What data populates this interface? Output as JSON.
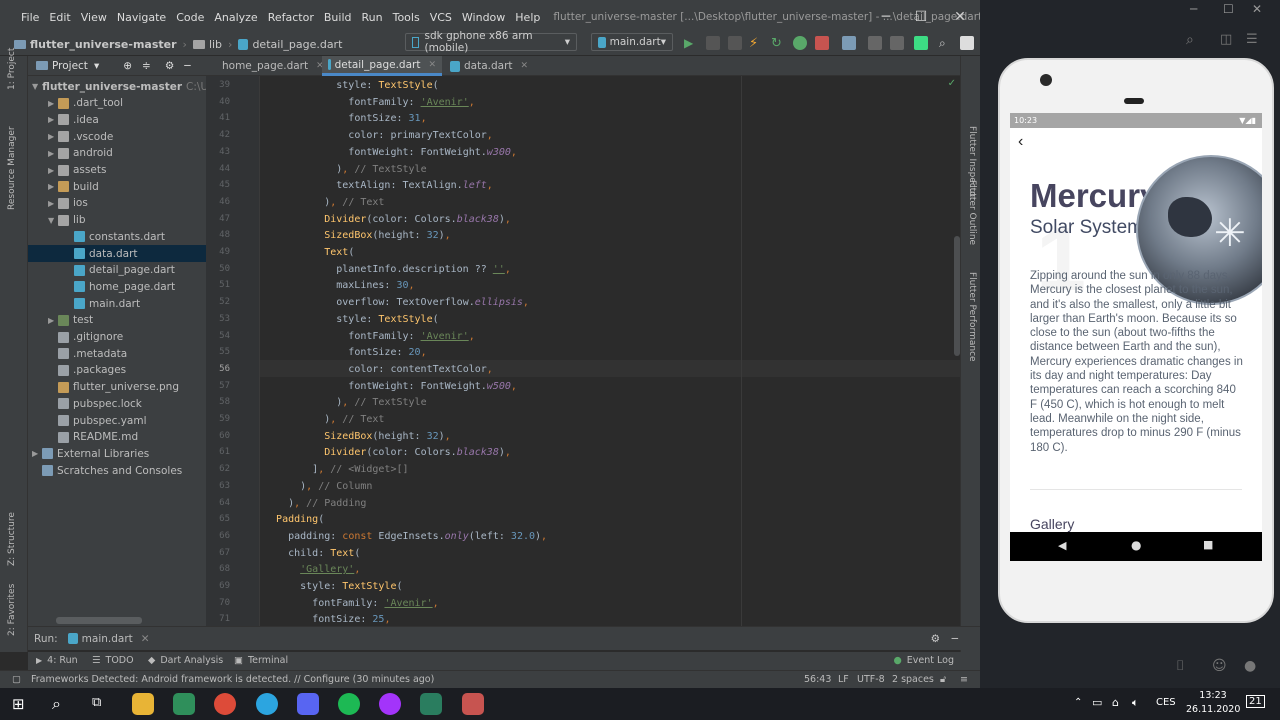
{
  "ide": {
    "menu": [
      "File",
      "Edit",
      "View",
      "Navigate",
      "Code",
      "Analyze",
      "Refactor",
      "Build",
      "Run",
      "Tools",
      "VCS",
      "Window",
      "Help"
    ],
    "window_title": "flutter_universe-master [...\\Desktop\\flutter_universe-master] - ...\\detail_page.dart",
    "breadcrumb": [
      "flutter_universe-master",
      "lib",
      "detail_page.dart"
    ],
    "device": "sdk gphone x86 arm (mobile)",
    "run_config": "main.dart",
    "project_header": "Project",
    "tree": [
      {
        "label": "flutter_universe-master",
        "suffix": "C:\\Users",
        "depth": 0,
        "arrow": "▼",
        "icon": "folder-icon"
      },
      {
        "label": ".dart_tool",
        "depth": 1,
        "arrow": "▶",
        "icon": "folder-icon"
      },
      {
        "label": ".idea",
        "depth": 1,
        "arrow": "▶",
        "icon": "folder-icon"
      },
      {
        "label": ".vscode",
        "depth": 1,
        "arrow": "▶",
        "icon": "folder-icon"
      },
      {
        "label": "android",
        "depth": 1,
        "arrow": "▶",
        "icon": "folder-icon"
      },
      {
        "label": "assets",
        "depth": 1,
        "arrow": "▶",
        "icon": "folder-icon"
      },
      {
        "label": "build",
        "depth": 1,
        "arrow": "▶",
        "icon": "folder-icon"
      },
      {
        "label": "ios",
        "depth": 1,
        "arrow": "▶",
        "icon": "folder-icon"
      },
      {
        "label": "lib",
        "depth": 1,
        "arrow": "▼",
        "icon": "folder-icon"
      },
      {
        "label": "constants.dart",
        "depth": 2,
        "arrow": "",
        "icon": "dart-file-icon"
      },
      {
        "label": "data.dart",
        "depth": 2,
        "arrow": "",
        "icon": "dart-file-icon",
        "selected": true
      },
      {
        "label": "detail_page.dart",
        "depth": 2,
        "arrow": "",
        "icon": "dart-file-icon"
      },
      {
        "label": "home_page.dart",
        "depth": 2,
        "arrow": "",
        "icon": "dart-file-icon"
      },
      {
        "label": "main.dart",
        "depth": 2,
        "arrow": "",
        "icon": "dart-file-icon"
      },
      {
        "label": "test",
        "depth": 1,
        "arrow": "▶",
        "icon": "folder-icon"
      },
      {
        "label": ".gitignore",
        "depth": 1,
        "arrow": "",
        "icon": "file-icon"
      },
      {
        "label": ".metadata",
        "depth": 1,
        "arrow": "",
        "icon": "file-icon"
      },
      {
        "label": ".packages",
        "depth": 1,
        "arrow": "",
        "icon": "file-icon"
      },
      {
        "label": "flutter_universe.png",
        "depth": 1,
        "arrow": "",
        "icon": "image-file-icon"
      },
      {
        "label": "pubspec.lock",
        "depth": 1,
        "arrow": "",
        "icon": "file-icon"
      },
      {
        "label": "pubspec.yaml",
        "depth": 1,
        "arrow": "",
        "icon": "file-icon"
      },
      {
        "label": "README.md",
        "depth": 1,
        "arrow": "",
        "icon": "file-icon"
      },
      {
        "label": "External Libraries",
        "depth": 0,
        "arrow": "▶",
        "icon": "library-icon"
      },
      {
        "label": "Scratches and Consoles",
        "depth": 0,
        "arrow": "",
        "icon": "console-icon"
      }
    ],
    "tabs": [
      "home_page.dart",
      "detail_page.dart",
      "data.dart"
    ],
    "left_tools": [
      "1: Project",
      "Resource Manager",
      "Z: Structure",
      "2: Favorites"
    ],
    "right_tools": [
      "Flutter Inspector",
      "Flutter Outline",
      "Flutter Performance"
    ],
    "code_lines": [
      {
        "n": "39",
        "code": "            style: TextStyle("
      },
      {
        "n": "40",
        "code": "              fontFamily: 'Avenir',"
      },
      {
        "n": "41",
        "code": "              fontSize: 31,"
      },
      {
        "n": "42",
        "code": "              color: primaryTextColor,"
      },
      {
        "n": "43",
        "code": "              fontWeight: FontWeight.w300,"
      },
      {
        "n": "44",
        "code": "            ), // TextStyle"
      },
      {
        "n": "45",
        "code": "            textAlign: TextAlign.left,"
      },
      {
        "n": "46",
        "code": "          ), // Text"
      },
      {
        "n": "47",
        "code": "          Divider(color: Colors.black38),"
      },
      {
        "n": "48",
        "code": "          SizedBox(height: 32),"
      },
      {
        "n": "49",
        "code": "          Text("
      },
      {
        "n": "50",
        "code": "            planetInfo.description ?? '',"
      },
      {
        "n": "51",
        "code": "            maxLines: 30,"
      },
      {
        "n": "52",
        "code": "            overflow: TextOverflow.ellipsis,"
      },
      {
        "n": "53",
        "code": "            style: TextStyle("
      },
      {
        "n": "54",
        "code": "              fontFamily: 'Avenir',"
      },
      {
        "n": "55",
        "code": "              fontSize: 20,"
      },
      {
        "n": "56",
        "code": "              color: contentTextColor,"
      },
      {
        "n": "57",
        "code": "              fontWeight: FontWeight.w500,"
      },
      {
        "n": "58",
        "code": "            ), // TextStyle"
      },
      {
        "n": "59",
        "code": "          ), // Text"
      },
      {
        "n": "60",
        "code": "          SizedBox(height: 32),"
      },
      {
        "n": "61",
        "code": "          Divider(color: Colors.black38),"
      },
      {
        "n": "62",
        "code": "        ], // <Widget>[]"
      },
      {
        "n": "63",
        "code": "      ), // Column"
      },
      {
        "n": "64",
        "code": "    ), // Padding"
      },
      {
        "n": "65",
        "code": "  Padding("
      },
      {
        "n": "66",
        "code": "    padding: const EdgeInsets.only(left: 32.0),"
      },
      {
        "n": "67",
        "code": "    child: Text("
      },
      {
        "n": "68",
        "code": "      'Gallery',"
      },
      {
        "n": "69",
        "code": "      style: TextStyle("
      },
      {
        "n": "70",
        "code": "        fontFamily: 'Avenir',"
      },
      {
        "n": "71",
        "code": "        fontSize: 25,"
      }
    ],
    "run_label": "Run:",
    "run_tab": "main.dart",
    "bottom_tools": [
      "4: Run",
      "TODO",
      "Dart Analysis",
      "Terminal"
    ],
    "event_log": "Event Log",
    "status_message": "Frameworks Detected: Android framework is detected. // Configure (30 minutes ago)",
    "status_right": [
      "56:43",
      "LF",
      "UTF-8",
      "2 spaces"
    ]
  },
  "phone": {
    "time": "10:23",
    "title": "Mercury",
    "subtitle": "Solar System",
    "description": "Zipping around the sun in only 88 days, Mercury is the closest planet to the sun, and it's also the smallest, only a little bit larger than Earth's moon. Because its so close to the sun (about two-fifths the distance between Earth and the sun), Mercury experiences dramatic changes in its day and night temperatures: Day temperatures can reach a scorching 840  F (450 C), which is hot enough to melt lead. Meanwhile on the night side, temperatures drop to minus 290 F (minus 180 C).",
    "gallery": "Gallery"
  },
  "taskbar": {
    "time": "13:23",
    "date": "26.11.2020",
    "lang": "CES",
    "notif_count": "21"
  },
  "colors": {
    "accent": "#4a88c7",
    "editor_bg": "#2b2b2b",
    "panel_bg": "#3c3f41"
  }
}
